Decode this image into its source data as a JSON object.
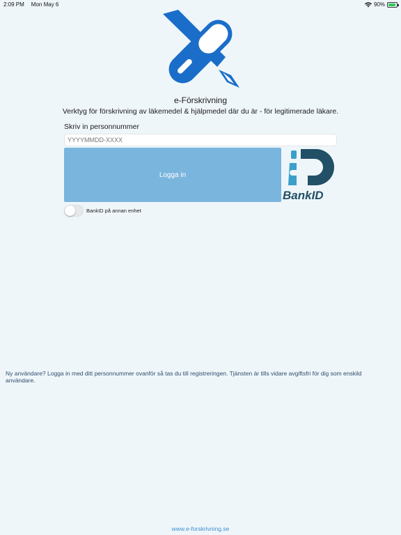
{
  "status_bar": {
    "time": "2:09 PM",
    "date": "Mon May 6",
    "battery_percent": "90%",
    "battery_level": 0.9,
    "icons": [
      "wifi-icon",
      "battery-icon"
    ]
  },
  "app": {
    "title": "e-Förskrivning",
    "subtitle": "Verktyg för förskrivning av läkemedel & hjälpmedel där du är - för legitimerade läkare."
  },
  "login": {
    "personnummer_label": "Skriv in personnummer",
    "personnummer_placeholder": "YYYYMMDD-XXXX",
    "login_button_label": "Logga in",
    "bankid_logo_text": "BankID",
    "other_device_label": "BankID på annan enhet",
    "other_device_on": false
  },
  "info_text": "Ny användare? Logga in med ditt personnummer ovanför så tas du till registreringen. Tjänsten är tills vidare avgiftsfri för dig som enskild användare.",
  "footer": {
    "link_text": "www.e-forskrivning.se"
  },
  "colors": {
    "background": "#eff6fa",
    "logo_blue": "#1a6ec9",
    "button_blue": "#7ab5dd",
    "bankid_dark": "#215067",
    "bankid_light": "#3b9fc9",
    "link": "#3f8ed0"
  }
}
